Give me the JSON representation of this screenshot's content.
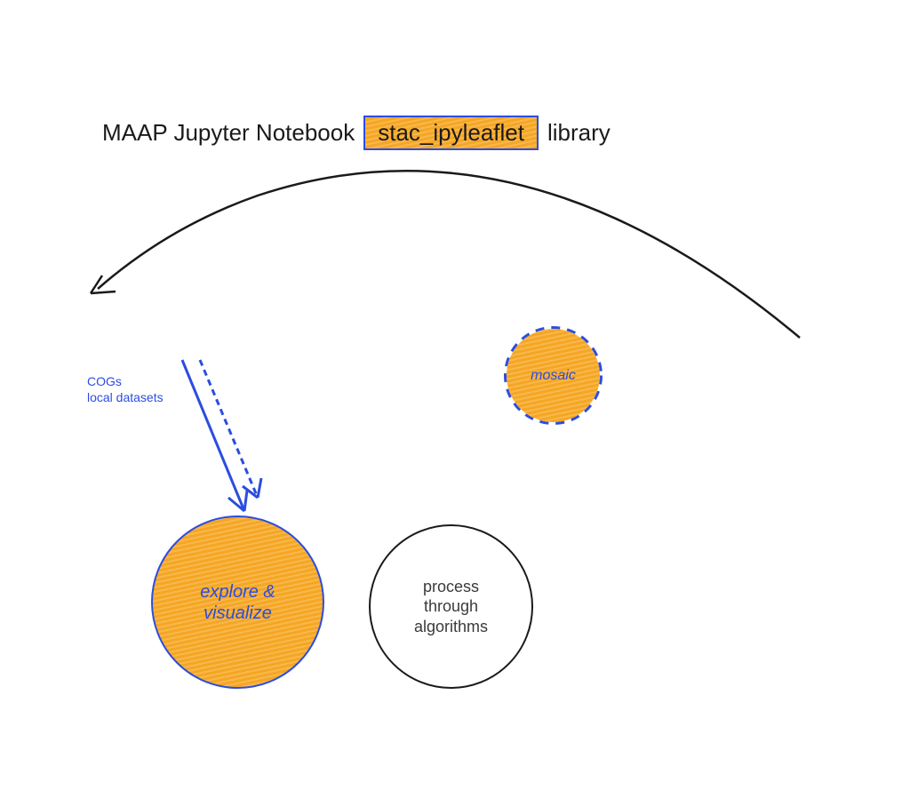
{
  "title": {
    "prefix": "MAAP Jupyter Notebook",
    "highlighted": "stac_ipyleaflet",
    "suffix": "library"
  },
  "labels": {
    "cogs_line1": "COGs",
    "cogs_line2": "local datasets",
    "mosaic": "mosaic",
    "explore_line1": "explore &",
    "explore_line2": "visualize",
    "process_line1": "process",
    "process_line2": "through",
    "process_line3": "algorithms"
  }
}
